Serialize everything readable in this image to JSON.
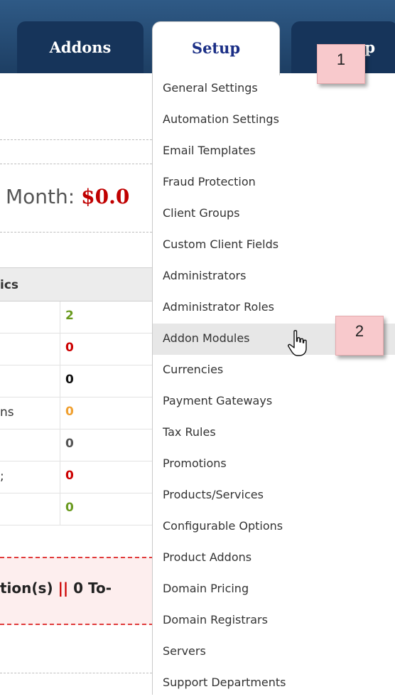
{
  "nav": {
    "tabs": [
      {
        "label": "Addons"
      },
      {
        "label": "Setup"
      },
      {
        "label": "p"
      }
    ]
  },
  "background": {
    "month_label": "Month:",
    "month_amount": "$0.0",
    "stats_header": "ics",
    "stats": [
      {
        "label": "",
        "value": "2",
        "color": "#6a9a1f"
      },
      {
        "label": "",
        "value": "0",
        "color": "#cc0000"
      },
      {
        "label": "",
        "value": "0",
        "color": "#111111"
      },
      {
        "label": "ns",
        "value": "0",
        "color": "#f0a030"
      },
      {
        "label": "",
        "value": "0",
        "color": "#555555"
      },
      {
        "label": ";",
        "value": "0",
        "color": "#cc0000"
      },
      {
        "label": "",
        "value": "0",
        "color": "#6a9a1f"
      }
    ],
    "todo_left": "tion(s)",
    "todo_sep": "||",
    "todo_right": "0 To-"
  },
  "menu": {
    "items": [
      {
        "label": "General Settings"
      },
      {
        "label": "Automation Settings"
      },
      {
        "label": "Email Templates"
      },
      {
        "label": "Fraud Protection"
      },
      {
        "label": "Client Groups"
      },
      {
        "label": "Custom Client Fields"
      },
      {
        "label": "Administrators"
      },
      {
        "label": "Administrator Roles"
      },
      {
        "label": "Addon Modules"
      },
      {
        "label": "Currencies"
      },
      {
        "label": "Payment Gateways"
      },
      {
        "label": "Tax Rules"
      },
      {
        "label": "Promotions"
      },
      {
        "label": "Products/Services"
      },
      {
        "label": "Configurable Options"
      },
      {
        "label": "Product Addons"
      },
      {
        "label": "Domain Pricing"
      },
      {
        "label": "Domain Registrars"
      },
      {
        "label": "Servers"
      },
      {
        "label": "Support Departments"
      }
    ],
    "hovered_item": "Addon Modules"
  },
  "callouts": {
    "one": "1",
    "two": "2"
  }
}
